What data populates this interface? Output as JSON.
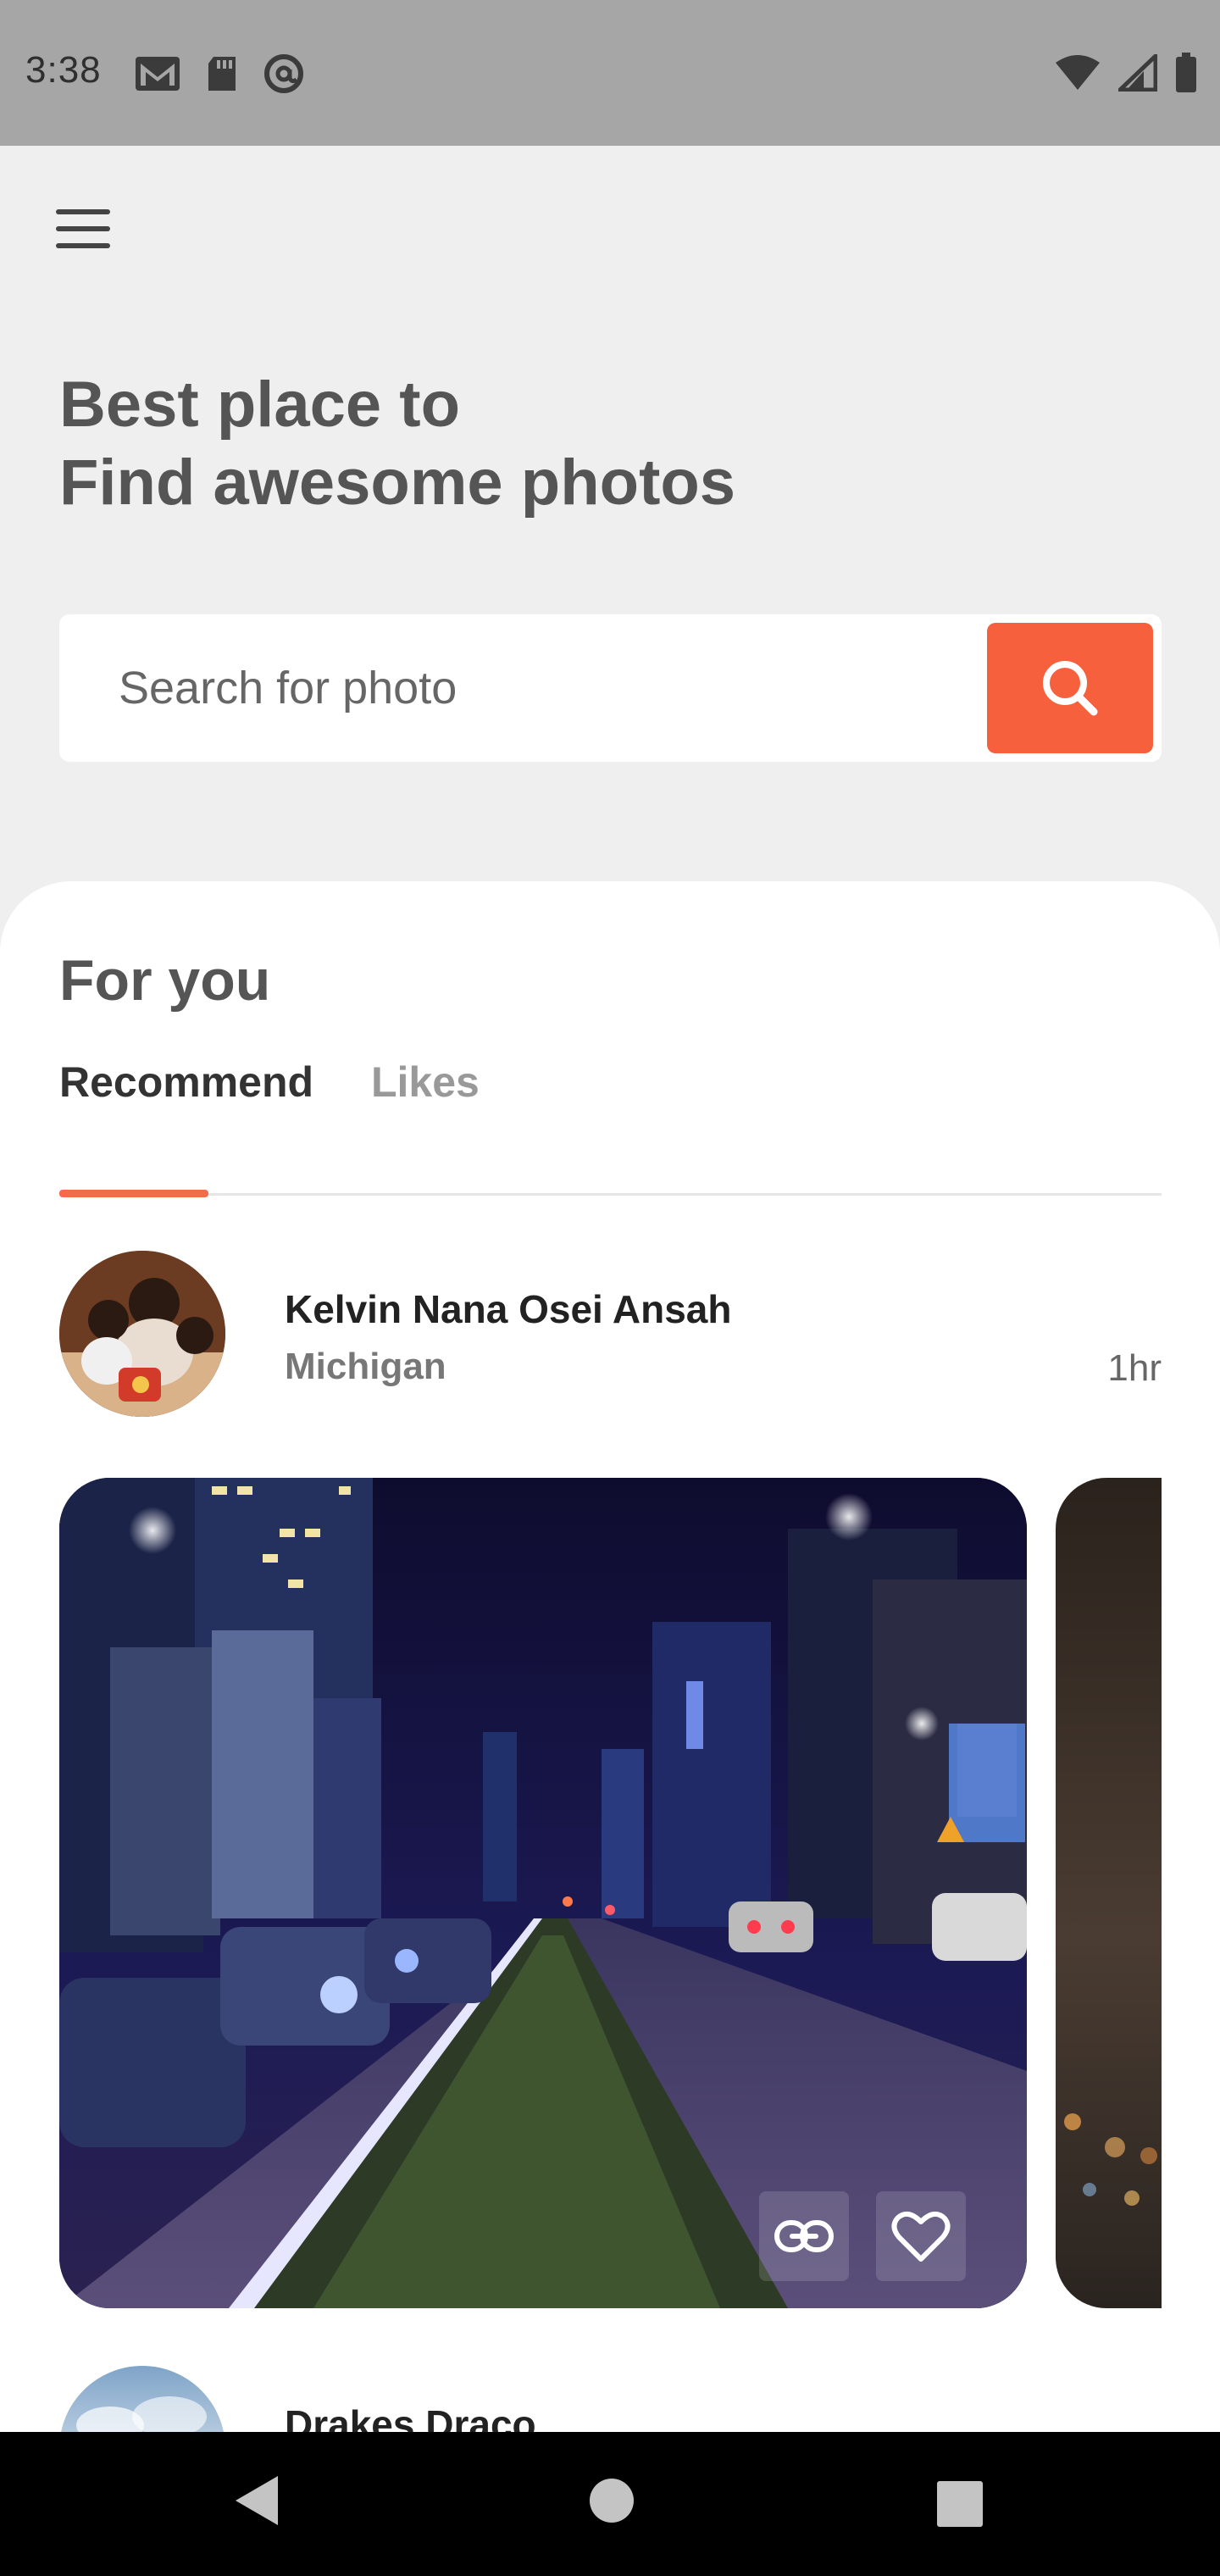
{
  "status_bar": {
    "time": "3:38",
    "left_icons": [
      "gmail-icon",
      "sd-card-icon",
      "at-sign-icon"
    ],
    "right_icons": [
      "wifi-icon",
      "cell-signal-icon",
      "battery-icon"
    ]
  },
  "header": {
    "menu_icon": "hamburger-menu-icon",
    "headline_line1": "Best place to",
    "headline_line2": "Find awesome photos"
  },
  "search": {
    "placeholder": "Search for photo",
    "button_icon": "search-icon",
    "accent_color": "#f7603d"
  },
  "feed": {
    "section_title": "For you",
    "tabs": [
      {
        "label": "Recommend",
        "active": true
      },
      {
        "label": "Likes",
        "active": false
      }
    ],
    "posts": [
      {
        "author": "Kelvin Nana Osei Ansah",
        "location": "Michigan",
        "time": "1hr",
        "actions": [
          "link-icon",
          "heart-icon"
        ]
      },
      {
        "author": "Drakes Draco"
      }
    ]
  },
  "nav_bar": {
    "buttons": [
      "back-icon",
      "home-icon",
      "recents-icon"
    ]
  }
}
